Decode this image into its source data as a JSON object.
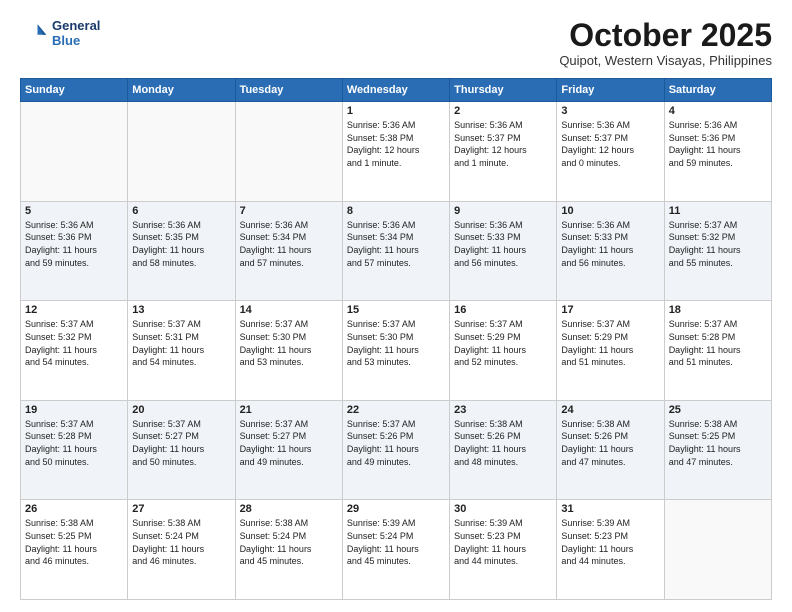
{
  "header": {
    "logo_line1": "General",
    "logo_line2": "Blue",
    "month": "October 2025",
    "location": "Quipot, Western Visayas, Philippines"
  },
  "weekdays": [
    "Sunday",
    "Monday",
    "Tuesday",
    "Wednesday",
    "Thursday",
    "Friday",
    "Saturday"
  ],
  "weeks": [
    [
      {
        "day": "",
        "info": ""
      },
      {
        "day": "",
        "info": ""
      },
      {
        "day": "",
        "info": ""
      },
      {
        "day": "1",
        "info": "Sunrise: 5:36 AM\nSunset: 5:38 PM\nDaylight: 12 hours\nand 1 minute."
      },
      {
        "day": "2",
        "info": "Sunrise: 5:36 AM\nSunset: 5:37 PM\nDaylight: 12 hours\nand 1 minute."
      },
      {
        "day": "3",
        "info": "Sunrise: 5:36 AM\nSunset: 5:37 PM\nDaylight: 12 hours\nand 0 minutes."
      },
      {
        "day": "4",
        "info": "Sunrise: 5:36 AM\nSunset: 5:36 PM\nDaylight: 11 hours\nand 59 minutes."
      }
    ],
    [
      {
        "day": "5",
        "info": "Sunrise: 5:36 AM\nSunset: 5:36 PM\nDaylight: 11 hours\nand 59 minutes."
      },
      {
        "day": "6",
        "info": "Sunrise: 5:36 AM\nSunset: 5:35 PM\nDaylight: 11 hours\nand 58 minutes."
      },
      {
        "day": "7",
        "info": "Sunrise: 5:36 AM\nSunset: 5:34 PM\nDaylight: 11 hours\nand 57 minutes."
      },
      {
        "day": "8",
        "info": "Sunrise: 5:36 AM\nSunset: 5:34 PM\nDaylight: 11 hours\nand 57 minutes."
      },
      {
        "day": "9",
        "info": "Sunrise: 5:36 AM\nSunset: 5:33 PM\nDaylight: 11 hours\nand 56 minutes."
      },
      {
        "day": "10",
        "info": "Sunrise: 5:36 AM\nSunset: 5:33 PM\nDaylight: 11 hours\nand 56 minutes."
      },
      {
        "day": "11",
        "info": "Sunrise: 5:37 AM\nSunset: 5:32 PM\nDaylight: 11 hours\nand 55 minutes."
      }
    ],
    [
      {
        "day": "12",
        "info": "Sunrise: 5:37 AM\nSunset: 5:32 PM\nDaylight: 11 hours\nand 54 minutes."
      },
      {
        "day": "13",
        "info": "Sunrise: 5:37 AM\nSunset: 5:31 PM\nDaylight: 11 hours\nand 54 minutes."
      },
      {
        "day": "14",
        "info": "Sunrise: 5:37 AM\nSunset: 5:30 PM\nDaylight: 11 hours\nand 53 minutes."
      },
      {
        "day": "15",
        "info": "Sunrise: 5:37 AM\nSunset: 5:30 PM\nDaylight: 11 hours\nand 53 minutes."
      },
      {
        "day": "16",
        "info": "Sunrise: 5:37 AM\nSunset: 5:29 PM\nDaylight: 11 hours\nand 52 minutes."
      },
      {
        "day": "17",
        "info": "Sunrise: 5:37 AM\nSunset: 5:29 PM\nDaylight: 11 hours\nand 51 minutes."
      },
      {
        "day": "18",
        "info": "Sunrise: 5:37 AM\nSunset: 5:28 PM\nDaylight: 11 hours\nand 51 minutes."
      }
    ],
    [
      {
        "day": "19",
        "info": "Sunrise: 5:37 AM\nSunset: 5:28 PM\nDaylight: 11 hours\nand 50 minutes."
      },
      {
        "day": "20",
        "info": "Sunrise: 5:37 AM\nSunset: 5:27 PM\nDaylight: 11 hours\nand 50 minutes."
      },
      {
        "day": "21",
        "info": "Sunrise: 5:37 AM\nSunset: 5:27 PM\nDaylight: 11 hours\nand 49 minutes."
      },
      {
        "day": "22",
        "info": "Sunrise: 5:37 AM\nSunset: 5:26 PM\nDaylight: 11 hours\nand 49 minutes."
      },
      {
        "day": "23",
        "info": "Sunrise: 5:38 AM\nSunset: 5:26 PM\nDaylight: 11 hours\nand 48 minutes."
      },
      {
        "day": "24",
        "info": "Sunrise: 5:38 AM\nSunset: 5:26 PM\nDaylight: 11 hours\nand 47 minutes."
      },
      {
        "day": "25",
        "info": "Sunrise: 5:38 AM\nSunset: 5:25 PM\nDaylight: 11 hours\nand 47 minutes."
      }
    ],
    [
      {
        "day": "26",
        "info": "Sunrise: 5:38 AM\nSunset: 5:25 PM\nDaylight: 11 hours\nand 46 minutes."
      },
      {
        "day": "27",
        "info": "Sunrise: 5:38 AM\nSunset: 5:24 PM\nDaylight: 11 hours\nand 46 minutes."
      },
      {
        "day": "28",
        "info": "Sunrise: 5:38 AM\nSunset: 5:24 PM\nDaylight: 11 hours\nand 45 minutes."
      },
      {
        "day": "29",
        "info": "Sunrise: 5:39 AM\nSunset: 5:24 PM\nDaylight: 11 hours\nand 45 minutes."
      },
      {
        "day": "30",
        "info": "Sunrise: 5:39 AM\nSunset: 5:23 PM\nDaylight: 11 hours\nand 44 minutes."
      },
      {
        "day": "31",
        "info": "Sunrise: 5:39 AM\nSunset: 5:23 PM\nDaylight: 11 hours\nand 44 minutes."
      },
      {
        "day": "",
        "info": ""
      }
    ]
  ]
}
